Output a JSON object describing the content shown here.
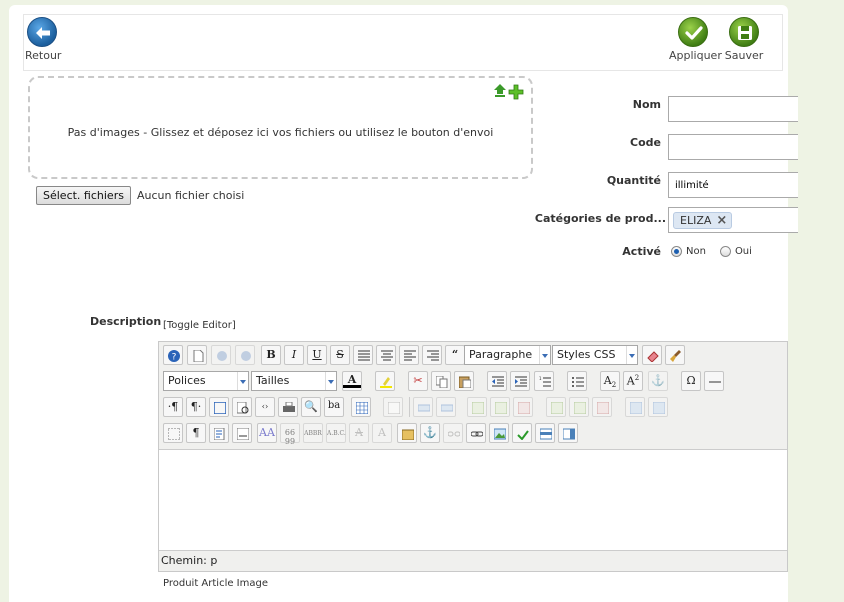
{
  "toolbar": {
    "back_label": "Retour",
    "apply_label": "Appliquer",
    "save_label": "Sauver"
  },
  "dropzone": {
    "message": "Pas d'images - Glissez et déposez ici vos fichiers ou utilisez le bouton d'envoi"
  },
  "file_input": {
    "button_label": "Sélect. fichiers",
    "status": "Aucun fichier choisi"
  },
  "form": {
    "name_label": "Nom",
    "name_value": "",
    "code_label": "Code",
    "code_value": "",
    "quantity_label": "Quantité",
    "quantity_value": "illimité",
    "categories_label": "Catégories de prod...",
    "categories_tags": [
      "ELIZA"
    ],
    "active_label": "Activé",
    "active_options": [
      "Non",
      "Oui"
    ],
    "active_selected": "Non",
    "description_label": "Description"
  },
  "editor": {
    "toggle_label": "[Toggle Editor]",
    "format_select": "Paragraphe",
    "styles_select": "Styles CSS",
    "fonts_select": "Polices",
    "sizes_select": "Tailles",
    "path_label": "Chemin: p"
  },
  "bottom": {
    "links": "Produit Article Image"
  },
  "colors": {
    "background": "#eef3e4",
    "button_blue": "#1c5f9e",
    "button_green": "#3f7d13"
  }
}
